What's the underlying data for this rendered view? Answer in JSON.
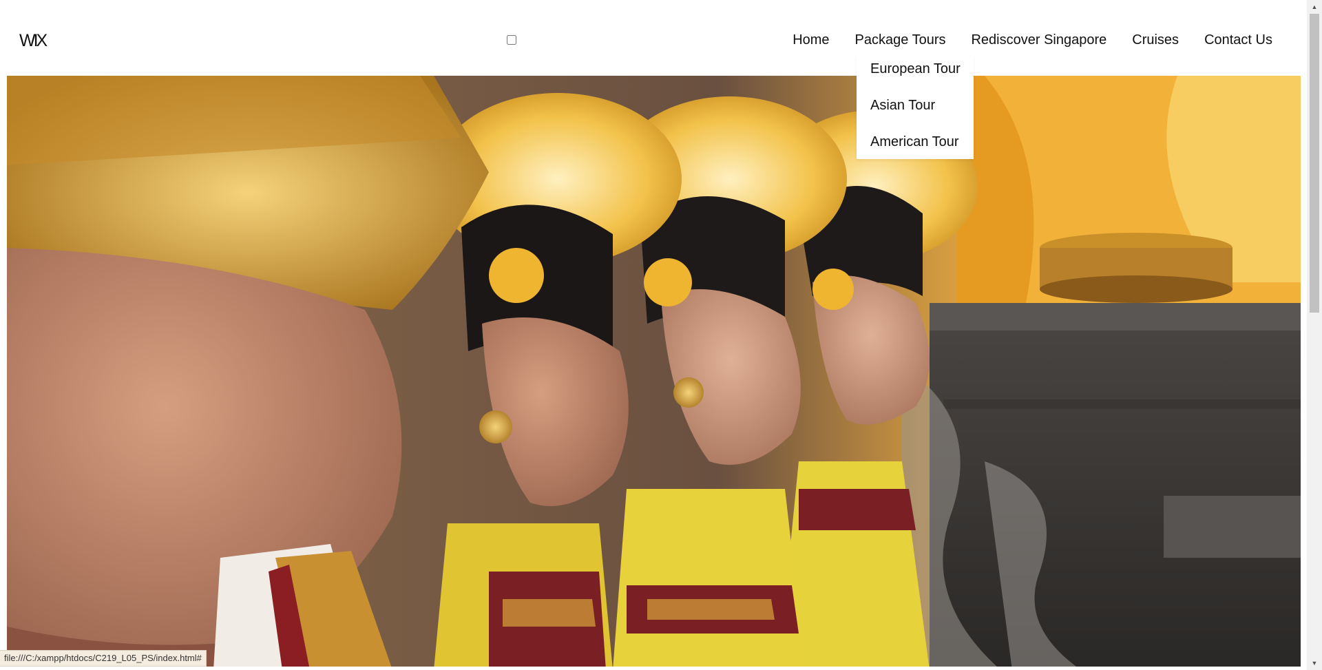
{
  "header": {
    "logo_text": "WIX",
    "nav": [
      {
        "label": "Home"
      },
      {
        "label": "Package Tours"
      },
      {
        "label": "Rediscover Singapore"
      },
      {
        "label": "Cruises"
      },
      {
        "label": "Contact Us"
      }
    ]
  },
  "dropdown": {
    "items": [
      {
        "label": "European Tour"
      },
      {
        "label": "Asian Tour"
      },
      {
        "label": "American Tour"
      }
    ]
  },
  "hero": {
    "image_subject": "balinese-ceremony-photo"
  },
  "statusbar": {
    "url": "file:///C:/xampp/htdocs/C219_L05_PS/index.html#"
  },
  "colors": {
    "text": "#111111",
    "background": "#ffffff",
    "gold": "#d9a12a",
    "yellow": "#e6d23a",
    "maroon": "#7a1f24"
  }
}
